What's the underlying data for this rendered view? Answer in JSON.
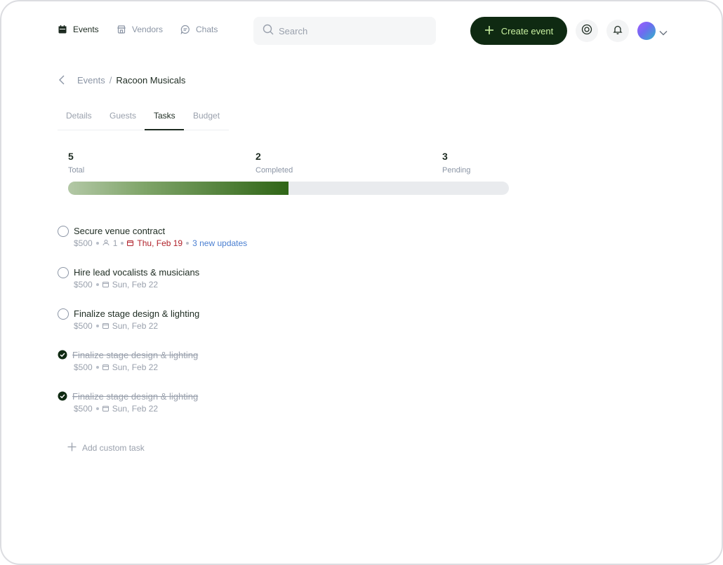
{
  "nav": {
    "items": [
      {
        "label": "Events",
        "icon": "calendar-icon",
        "active": true
      },
      {
        "label": "Vendors",
        "icon": "store-icon",
        "active": false
      },
      {
        "label": "Chats",
        "icon": "chat-icon",
        "active": false
      }
    ]
  },
  "search": {
    "placeholder": "Search"
  },
  "header": {
    "create_label": "Create event"
  },
  "breadcrumb": {
    "parent": "Events",
    "separator": "/",
    "current": "Racoon Musicals"
  },
  "tabs": [
    {
      "label": "Details",
      "active": false
    },
    {
      "label": "Guests",
      "active": false
    },
    {
      "label": "Tasks",
      "active": true
    },
    {
      "label": "Budget",
      "active": false
    }
  ],
  "stats": {
    "total": {
      "value": "5",
      "label": "Total"
    },
    "completed": {
      "value": "2",
      "label": "Completed"
    },
    "pending": {
      "value": "3",
      "label": "Pending"
    },
    "progress_fraction": 0.5
  },
  "tasks": [
    {
      "title": "Secure venue contract",
      "cost": "$500",
      "assignees": "1",
      "due": "Thu, Feb 19",
      "due_overdue": true,
      "updates": "3 new updates",
      "done": false
    },
    {
      "title": "Hire lead vocalists & musicians",
      "cost": "$500",
      "due": "Sun, Feb 22",
      "done": false
    },
    {
      "title": "Finalize stage design & lighting",
      "cost": "$500",
      "due": "Sun, Feb 22",
      "done": false
    },
    {
      "title": "Finalize stage design & lighting",
      "cost": "$500",
      "due": "Sun, Feb 22",
      "done": true
    },
    {
      "title": "Finalize stage design & lighting",
      "cost": "$500",
      "due": "Sun, Feb 22",
      "done": true
    }
  ],
  "add_task_label": "Add custom task",
  "colors": {
    "accent_dark": "#0f2a12",
    "accent_text": "#c8f0a0",
    "overdue": "#b0222b",
    "link": "#4a7fd1"
  }
}
